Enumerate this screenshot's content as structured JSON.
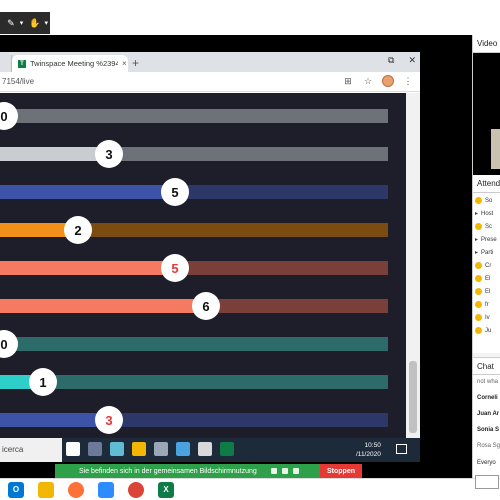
{
  "browser": {
    "tab_title": "Twinspace Meeting %2394444",
    "tab_close": "×",
    "new_tab": "+",
    "url": "7154/live",
    "window_controls": [
      "⧉",
      "✕"
    ]
  },
  "bars": [
    {
      "value": "0",
      "fill_color": "#6d7278",
      "track_color": "#6d7278",
      "fill_fraction": 0.0,
      "text_color": "#111111"
    },
    {
      "value": "3",
      "fill_color": "#c9ccd1",
      "track_color": "#6d7278",
      "fill_fraction": 0.25,
      "text_color": "#111111"
    },
    {
      "value": "5",
      "fill_color": "#3d53a8",
      "track_color": "#2c3868",
      "fill_fraction": 0.42,
      "text_color": "#111111"
    },
    {
      "value": "2",
      "fill_color": "#f39019",
      "track_color": "#7a4c12",
      "fill_fraction": 0.17,
      "text_color": "#111111"
    },
    {
      "value": "5",
      "fill_color": "#f57a5f",
      "track_color": "#7a3f38",
      "fill_fraction": 0.42,
      "text_color": "#e53935"
    },
    {
      "value": "6",
      "fill_color": "#f57a5f",
      "track_color": "#7a3f38",
      "fill_fraction": 0.5,
      "text_color": "#111111"
    },
    {
      "value": "0",
      "fill_color": "#2d6b6a",
      "track_color": "#2d6b6a",
      "fill_fraction": 0.0,
      "text_color": "#111111"
    },
    {
      "value": "1",
      "fill_color": "#2ecfc9",
      "track_color": "#2d6b6a",
      "fill_fraction": 0.08,
      "text_color": "#111111"
    },
    {
      "value": "3",
      "fill_color": "#3d53a8",
      "track_color": "#2c3868",
      "fill_fraction": 0.25,
      "text_color": "#e53935"
    }
  ],
  "taskbar": {
    "search_text": "icerca",
    "time": "10:50",
    "date": "/11/2020",
    "apps": [
      "#fff",
      "#6b7a99",
      "#5fbcd3",
      "#f2b705",
      "#9aa7b8",
      "#4aa3df",
      "#d9d9d9",
      "#0f7b47"
    ]
  },
  "share": {
    "banner_text": "Sie befinden sich in der gemeinsamen Bildschirmnutzung",
    "stop_label": "Stoppen"
  },
  "right_panel": {
    "video_title": "Video",
    "attend_title": "Attend",
    "attendees": [
      {
        "label": "So",
        "kind": "tab"
      },
      {
        "label": "Host",
        "kind": "group"
      },
      {
        "label": "Sc",
        "kind": "person"
      },
      {
        "label": "Prese",
        "kind": "group"
      },
      {
        "label": "Parti",
        "kind": "group"
      },
      {
        "label": "Cr",
        "kind": "person"
      },
      {
        "label": "El",
        "kind": "person"
      },
      {
        "label": "El",
        "kind": "person"
      },
      {
        "label": "fr",
        "kind": "person"
      },
      {
        "label": "Iv",
        "kind": "person"
      },
      {
        "label": "Ju",
        "kind": "person"
      }
    ],
    "chat_title": "Chat",
    "chat_lines": [
      {
        "text": "not wha",
        "bold": false
      },
      {
        "text": "Corneli",
        "bold": true
      },
      {
        "text": "Juan Ar",
        "bold": true
      },
      {
        "text": "Sonia S",
        "bold": true
      },
      {
        "text": "Rosa Sg",
        "bold": false
      }
    ],
    "chat_to": "Everyo"
  }
}
